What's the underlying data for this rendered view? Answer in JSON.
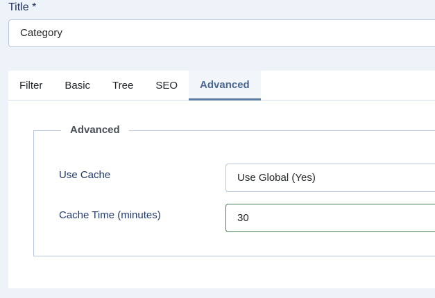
{
  "title": {
    "label": "Title *",
    "value": "Category"
  },
  "tabs": [
    {
      "label": "Filter"
    },
    {
      "label": "Basic"
    },
    {
      "label": "Tree"
    },
    {
      "label": "SEO"
    },
    {
      "label": "Advanced",
      "active": true
    }
  ],
  "advanced": {
    "legend": "Advanced",
    "use_cache": {
      "label": "Use Cache",
      "value": "Use Global (Yes)"
    },
    "cache_time": {
      "label": "Cache Time (minutes)",
      "value": "30"
    }
  },
  "colors": {
    "accent": "#5a7aa3",
    "valid_border": "#457d54",
    "label": "#22396b"
  }
}
